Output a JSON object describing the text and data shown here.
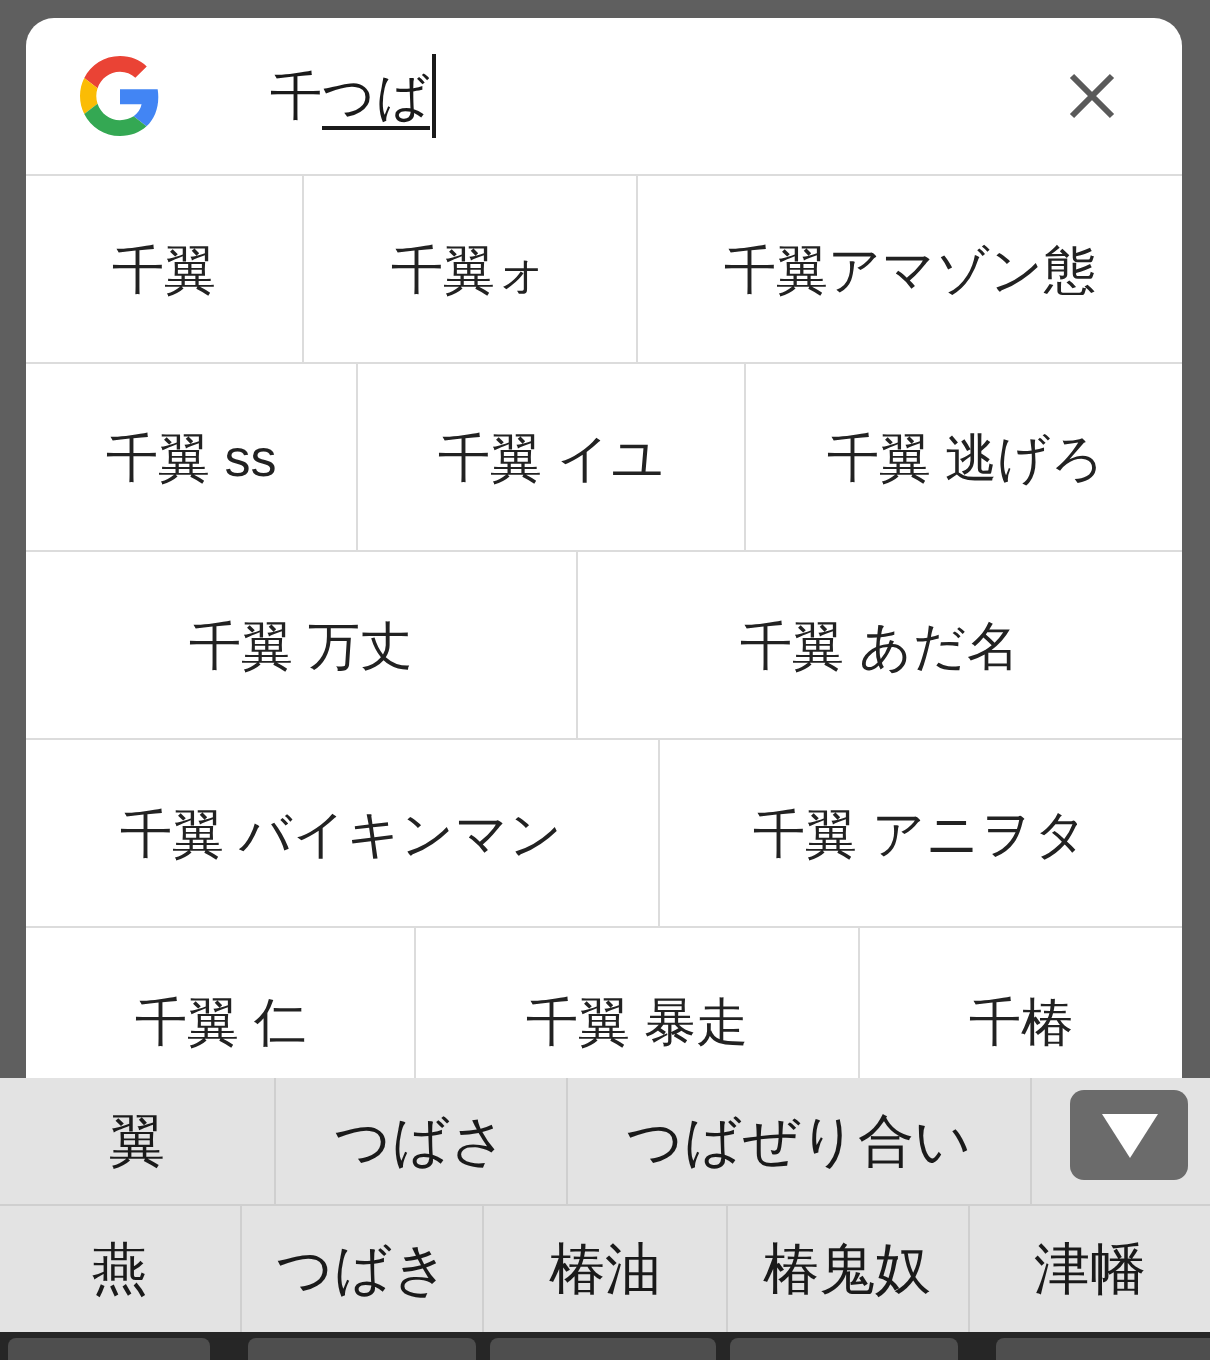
{
  "search": {
    "query": [
      {
        "text": "千",
        "composing": false
      },
      {
        "text": "つば",
        "composing": true
      }
    ]
  },
  "suggestion_rows": [
    [
      "千翼",
      "千翼ォ",
      "千翼アマゾン態"
    ],
    [
      "千翼 ss",
      "千翼 イユ",
      "千翼 逃げろ"
    ],
    [
      "千翼 万丈",
      "千翼 あだ名"
    ],
    [
      "千翼 バイキンマン",
      "千翼 アニヲタ"
    ],
    [
      "千翼 仁",
      "千翼 暴走",
      "千椿"
    ]
  ],
  "candidate_rows": [
    [
      "翼",
      "つばさ",
      "つばぜり合い"
    ],
    [
      "燕",
      "つばき",
      "椿油",
      "椿鬼奴",
      "津幡"
    ]
  ]
}
